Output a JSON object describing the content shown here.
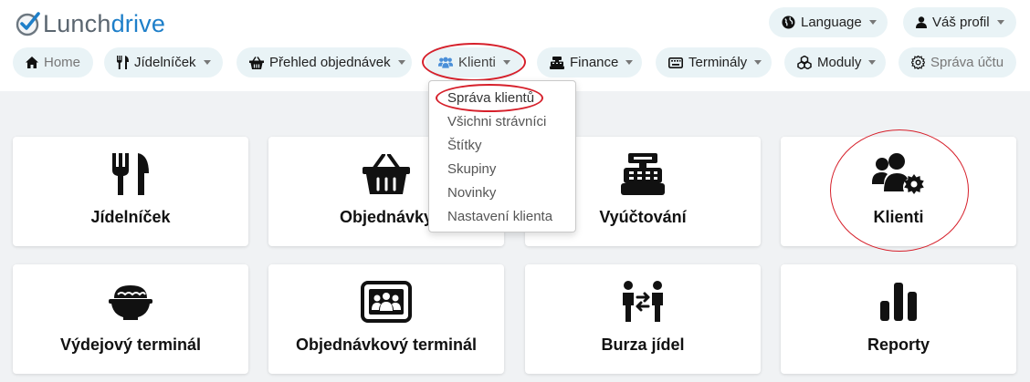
{
  "brand": {
    "part1": "Lunch",
    "part2": "drive",
    "accent_color": "#1e7fc9"
  },
  "header": {
    "language_label": "Language",
    "language_icon": "globe-icon",
    "profile_label": "Váš profil",
    "profile_icon": "user-icon"
  },
  "nav": {
    "items": [
      {
        "label": "Home",
        "icon": "home-icon"
      },
      {
        "label": "Jídelníček",
        "icon": "utensils-icon"
      },
      {
        "label": "Přehled objednávek",
        "icon": "basket-icon"
      },
      {
        "label": "Klienti",
        "icon": "users-icon"
      },
      {
        "label": "Finance",
        "icon": "cash-register-icon"
      },
      {
        "label": "Terminály",
        "icon": "keyboard-icon"
      },
      {
        "label": "Moduly",
        "icon": "cubes-icon"
      },
      {
        "label": "Správa účtu",
        "icon": "gear-icon"
      }
    ]
  },
  "klienti_menu": {
    "items": [
      "Správa klientů",
      "Všichni strávníci",
      "Štítky",
      "Skupiny",
      "Novinky",
      "Nastavení klienta"
    ]
  },
  "tiles": [
    {
      "label": "Jídelníček",
      "icon": "utensils-icon"
    },
    {
      "label": "Objednávky",
      "icon": "basket-icon"
    },
    {
      "label": "Vyúčtování",
      "icon": "cash-register-icon"
    },
    {
      "label": "Klienti",
      "icon": "users-gear-icon"
    },
    {
      "label": "Výdejový terminál",
      "icon": "bowl-icon"
    },
    {
      "label": "Objednávkový terminál",
      "icon": "terminal-people-icon"
    },
    {
      "label": "Burza jídel",
      "icon": "exchange-people-icon"
    },
    {
      "label": "Reporty",
      "icon": "bar-chart-icon"
    }
  ],
  "colors": {
    "highlight_red": "#d6202b",
    "pill_bg": "#e9f3f6",
    "page_bg": "#f0f2f4"
  }
}
